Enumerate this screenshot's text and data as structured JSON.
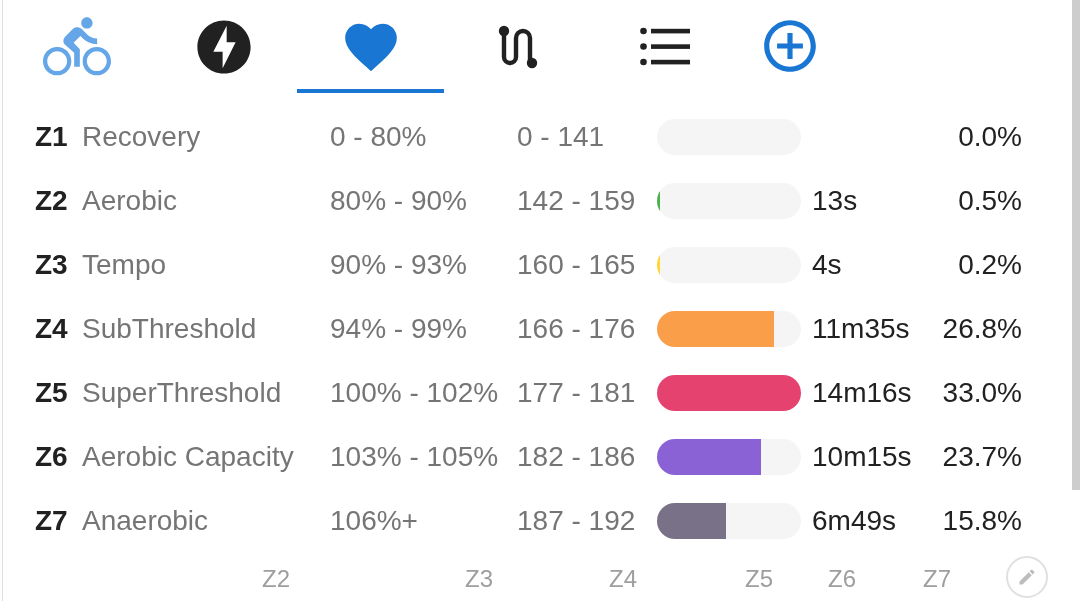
{
  "tabs": [
    {
      "selected": false
    },
    {
      "selected": false
    },
    {
      "selected": true
    },
    {
      "selected": false
    },
    {
      "selected": false
    }
  ],
  "zones": [
    {
      "code": "Z1",
      "name": "Recovery",
      "percent_range": "0 - 80%",
      "bpm_range": "0 - 141",
      "percent": "0.0%"
    },
    {
      "code": "Z2",
      "name": "Aerobic",
      "percent_range": "80% - 90%",
      "bpm_range": "142 - 159",
      "level": 0.015,
      "color": "#4caf50",
      "time": "13s",
      "percent": "0.5%"
    },
    {
      "code": "Z3",
      "name": "Tempo",
      "percent_range": "90% - 93%",
      "bpm_range": "160 - 165",
      "level": 0.006,
      "color": "#fdd835",
      "time": "4s",
      "percent": "0.2%"
    },
    {
      "code": "Z4",
      "name": "SubThreshold",
      "percent_range": "94% - 99%",
      "bpm_range": "166 - 176",
      "level": 0.81,
      "color": "#fb9e4a",
      "time": "11m35s",
      "percent": "26.8%"
    },
    {
      "code": "Z5",
      "name": "SuperThreshold",
      "percent_range": "100% - 102%",
      "bpm_range": "177 - 181",
      "level": 1,
      "color": "#e5426f",
      "time": "14m16s",
      "percent": "33.0%"
    },
    {
      "code": "Z6",
      "name": "Aerobic Capacity",
      "percent_range": "103% - 105%",
      "bpm_range": "182 - 186",
      "level": 0.72,
      "color": "#8b62d6",
      "time": "10m15s",
      "percent": "23.7%"
    },
    {
      "code": "Z7",
      "name": "Anaerobic",
      "percent_range": "106%+",
      "bpm_range": "187 - 192",
      "level": 0.48,
      "color": "#797187",
      "time": "6m49s",
      "percent": "15.8%"
    }
  ],
  "zone_chart": {
    "axis_labels": [
      "Z2",
      "Z3",
      "Z4",
      "Z5",
      "Z6",
      "Z7"
    ]
  }
}
